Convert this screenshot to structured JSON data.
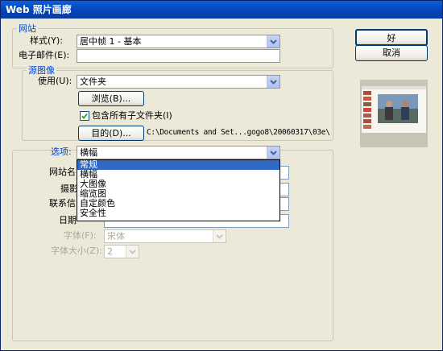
{
  "window": {
    "title": "Web 照片画廊"
  },
  "site": {
    "legend": "网站",
    "style_label": "样式(Y):",
    "style_value": "居中帧 1 - 基本",
    "email_label": "电子邮件(E):",
    "email_value": ""
  },
  "source": {
    "legend": "源图像",
    "use_label": "使用(U):",
    "use_value": "文件夹",
    "browse_label": "浏览(B)...",
    "include_sub_label": "包含所有子文件夹(I)",
    "include_sub_checked": true,
    "dest_label": "目的(D)...",
    "dest_path": "C:\\Documents and Set...gogo8\\20060317\\03e\\"
  },
  "options": {
    "label": "选项:",
    "selected": "横幅",
    "dropdown_items": [
      "常规",
      "横幅",
      "大图像",
      "缩览图",
      "自定颜色",
      "安全性"
    ],
    "highlighted_index": 0,
    "fields": [
      {
        "label": "网站名",
        "value": ""
      },
      {
        "label": "摄影",
        "value": ""
      },
      {
        "label": "联系信",
        "value": ""
      },
      {
        "label": "日期",
        "value": ""
      }
    ],
    "font_label": "字体(F):",
    "font_value": "宋体",
    "size_label": "字体大小(Z):",
    "size_value": "2"
  },
  "buttons": {
    "ok": "好",
    "cancel": "取消"
  },
  "colors": {
    "accent": "#0046d5",
    "highlight": "#316ac5",
    "titlebar": "#0a5fd8"
  }
}
